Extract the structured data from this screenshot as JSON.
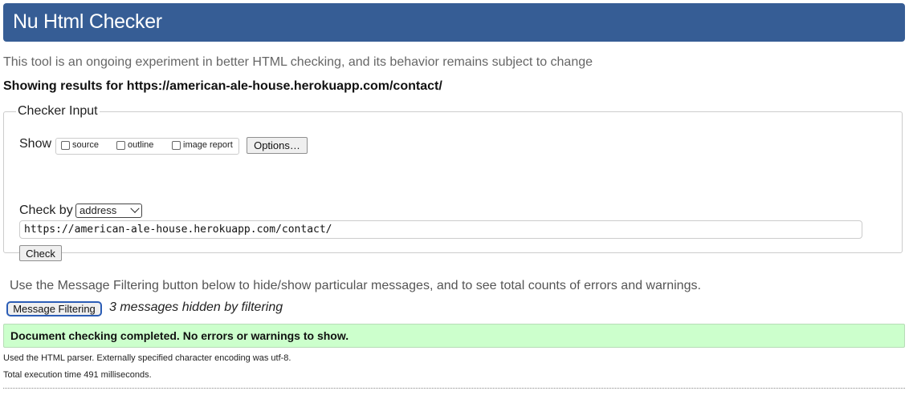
{
  "header": {
    "title": "Nu Html Checker"
  },
  "intro": "This tool is an ongoing experiment in better HTML checking, and its behavior remains subject to change",
  "showing_results": "Showing results for https://american-ale-house.herokuapp.com/contact/",
  "checker_input": {
    "legend": "Checker Input",
    "show_label": "Show",
    "show_options": [
      {
        "label": "source",
        "checked": false
      },
      {
        "label": "outline",
        "checked": false
      },
      {
        "label": "image report",
        "checked": false
      }
    ],
    "options_button": "Options…",
    "check_by_label": "Check by",
    "check_by_selected": "address",
    "url_value": "https://american-ale-house.herokuapp.com/contact/",
    "check_button": "Check"
  },
  "filtering": {
    "note": "Use the Message Filtering button below to hide/show particular messages, and to see total counts of errors and warnings.",
    "button": "Message Filtering",
    "hidden_count_text": "3 messages hidden by filtering"
  },
  "result": {
    "success_message": "Document checking completed. No errors or warnings to show."
  },
  "details": {
    "parser": "Used the HTML parser. Externally specified character encoding was utf-8.",
    "execution_time": "Total execution time 491 milliseconds."
  },
  "colors": {
    "header_bg": "#365D95",
    "success_bg": "#ccffcc",
    "filter_button_border": "#2B5DB6"
  }
}
